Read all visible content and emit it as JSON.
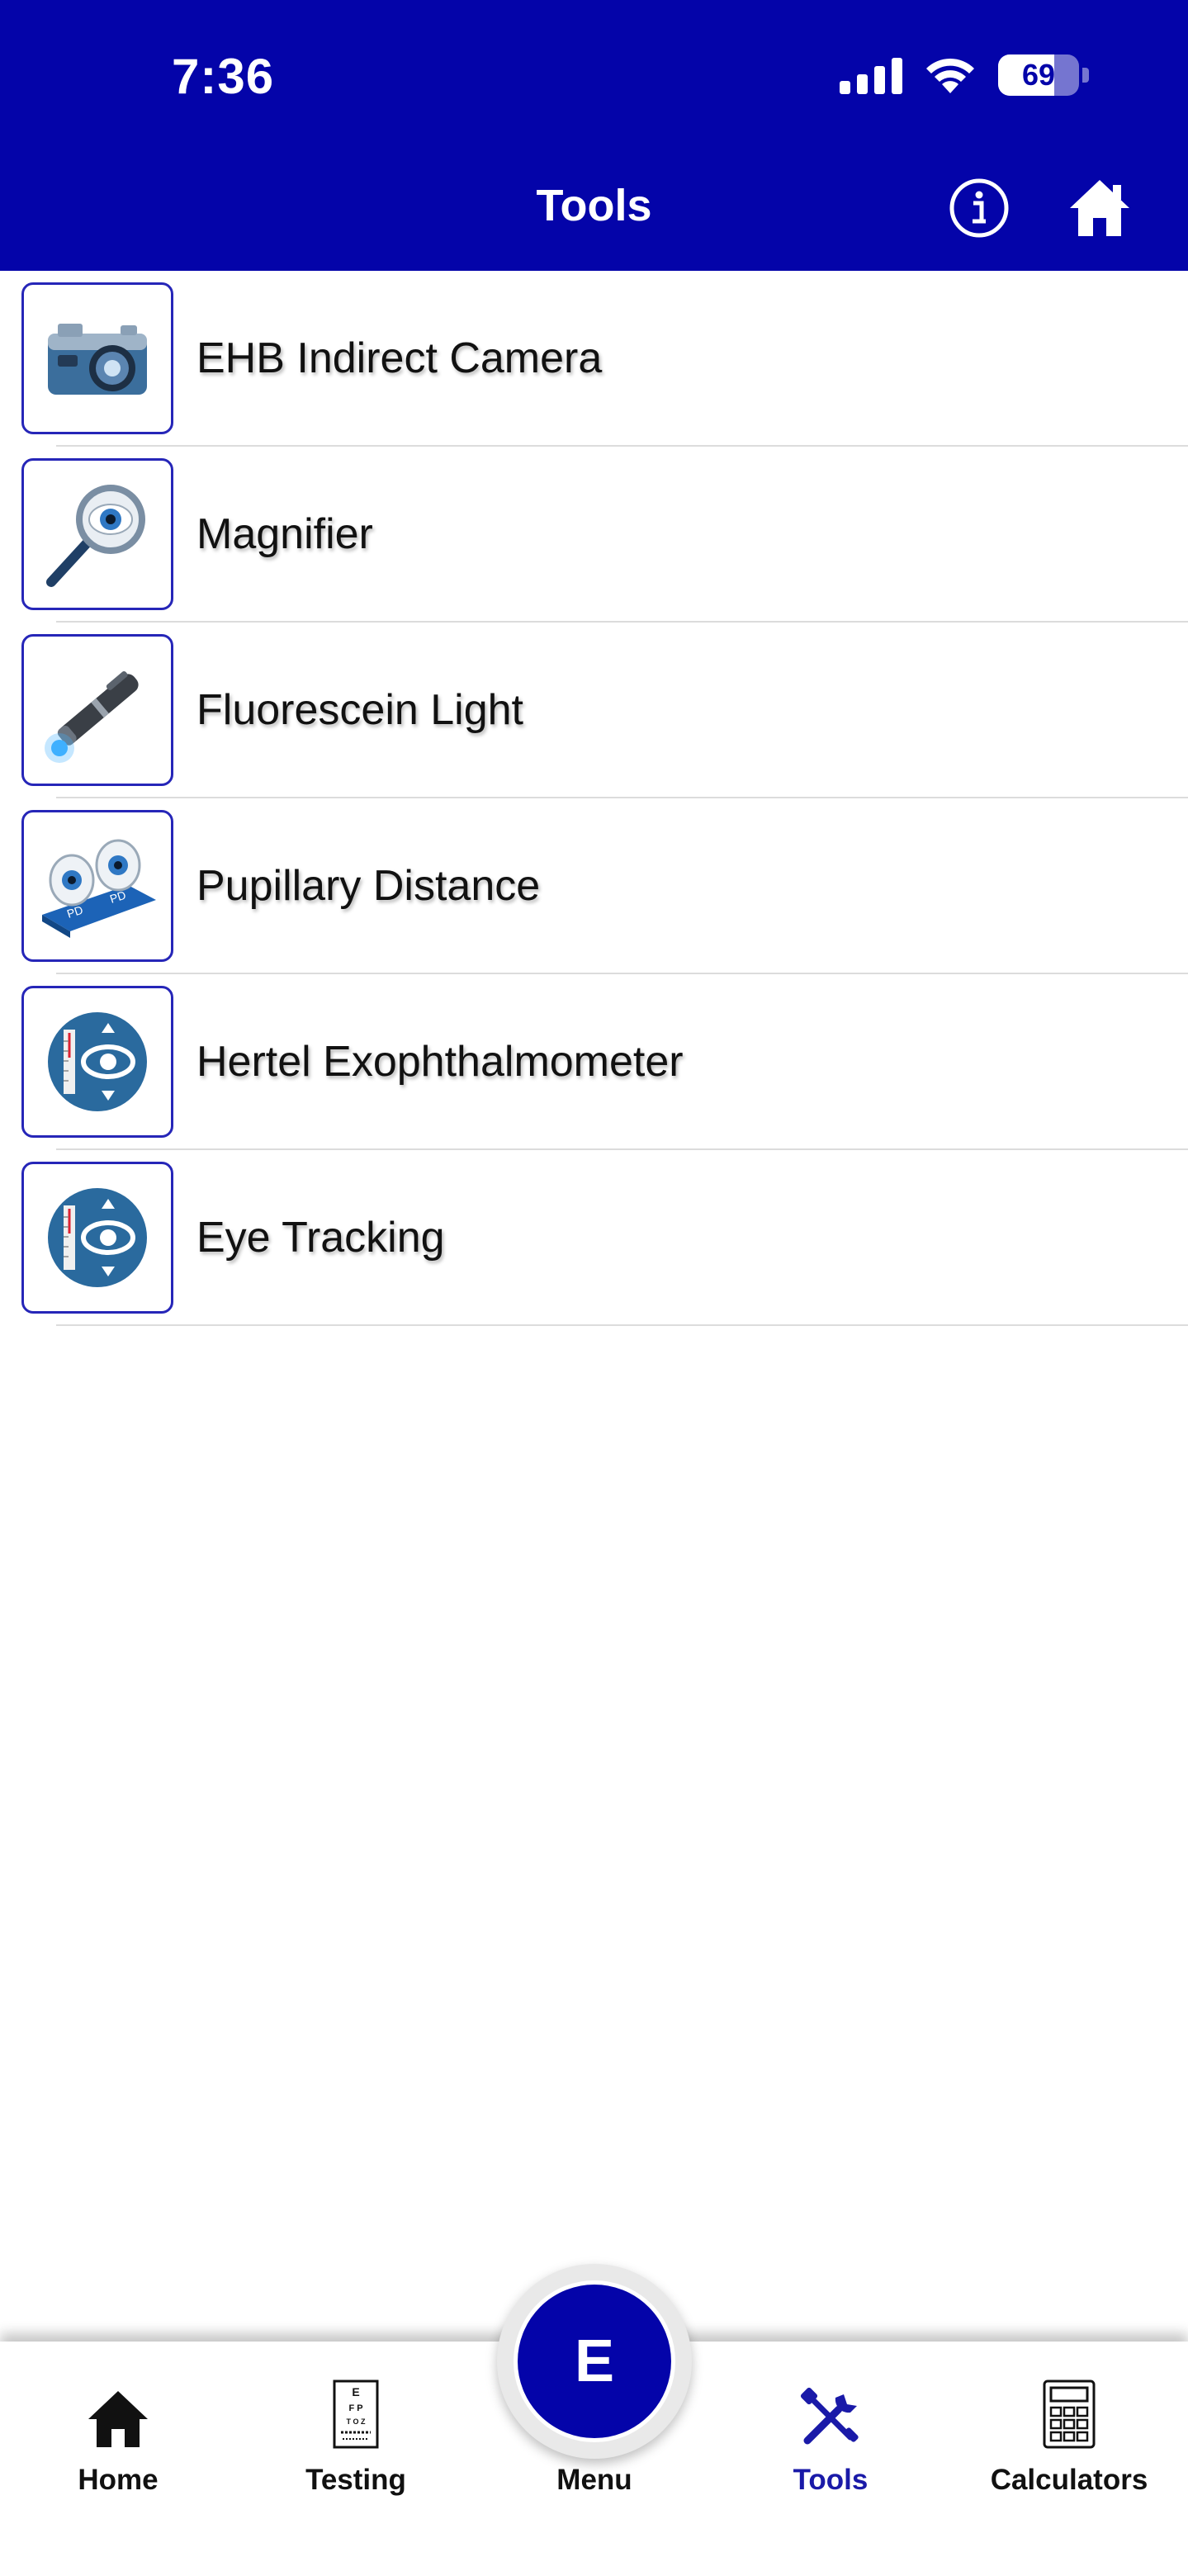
{
  "status": {
    "time": "7:36",
    "battery": "69",
    "battery_level": 0.69
  },
  "header": {
    "title": "Tools",
    "info_icon": "info-icon",
    "home_icon": "home-icon"
  },
  "tools": [
    {
      "label": "EHB Indirect Camera",
      "icon": "camera-icon"
    },
    {
      "label": "Magnifier",
      "icon": "magnifier-icon"
    },
    {
      "label": "Fluorescein Light",
      "icon": "penlight-icon"
    },
    {
      "label": "Pupillary Distance",
      "icon": "pupillary-distance-icon"
    },
    {
      "label": "Hertel Exophthalmometer",
      "icon": "exophthalmometer-icon"
    },
    {
      "label": "Eye Tracking",
      "icon": "eye-tracking-icon"
    }
  ],
  "tabbar": {
    "home": "Home",
    "testing": "Testing",
    "menu": "Menu",
    "menu_badge": "E",
    "tools": "Tools",
    "calculators": "Calculators",
    "active": "Tools"
  },
  "colors": {
    "brand": "#0404a9",
    "active_tab": "#1a1aa8",
    "thumb_border": "#2626b8"
  }
}
